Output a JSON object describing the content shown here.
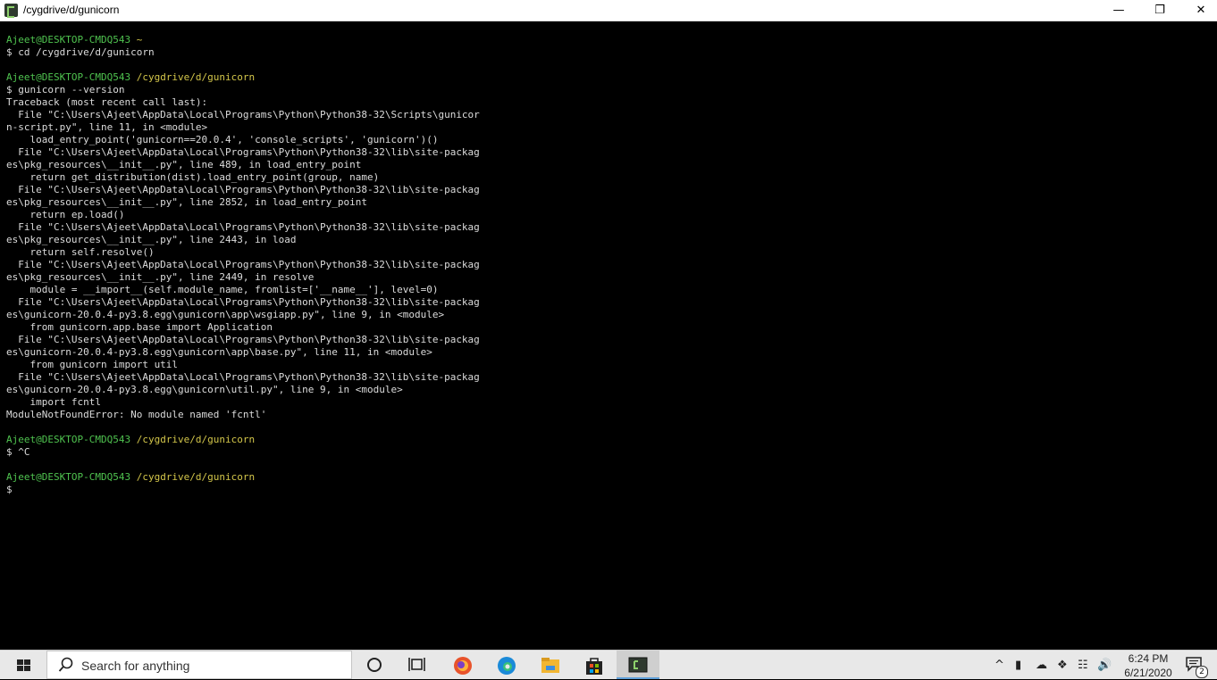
{
  "window": {
    "title": "/cygdrive/d/gunicorn",
    "minimize_glyph": "—",
    "maximize_glyph": "❐",
    "close_glyph": "✕"
  },
  "terminal": {
    "lines": [
      {
        "segments": [
          {
            "text": "Ajeet@DESKTOP-CMDQ543",
            "color": "green"
          },
          {
            "text": " ~",
            "color": "yellow"
          }
        ]
      },
      {
        "segments": [
          {
            "text": "$ cd /cygdrive/d/gunicorn",
            "color": "white"
          }
        ]
      },
      {
        "segments": [
          {
            "text": "",
            "color": "white"
          }
        ]
      },
      {
        "segments": [
          {
            "text": "Ajeet@DESKTOP-CMDQ543",
            "color": "green"
          },
          {
            "text": " /cygdrive/d/gunicorn",
            "color": "yellow"
          }
        ]
      },
      {
        "segments": [
          {
            "text": "$ gunicorn --version",
            "color": "white"
          }
        ]
      },
      {
        "segments": [
          {
            "text": "Traceback (most recent call last):",
            "color": "white"
          }
        ]
      },
      {
        "segments": [
          {
            "text": "  File \"C:\\Users\\Ajeet\\AppData\\Local\\Programs\\Python\\Python38-32\\Scripts\\gunicor",
            "color": "white"
          }
        ]
      },
      {
        "segments": [
          {
            "text": "n-script.py\", line 11, in <module>",
            "color": "white"
          }
        ]
      },
      {
        "segments": [
          {
            "text": "    load_entry_point('gunicorn==20.0.4', 'console_scripts', 'gunicorn')()",
            "color": "white"
          }
        ]
      },
      {
        "segments": [
          {
            "text": "  File \"C:\\Users\\Ajeet\\AppData\\Local\\Programs\\Python\\Python38-32\\lib\\site-packag",
            "color": "white"
          }
        ]
      },
      {
        "segments": [
          {
            "text": "es\\pkg_resources\\__init__.py\", line 489, in load_entry_point",
            "color": "white"
          }
        ]
      },
      {
        "segments": [
          {
            "text": "    return get_distribution(dist).load_entry_point(group, name)",
            "color": "white"
          }
        ]
      },
      {
        "segments": [
          {
            "text": "  File \"C:\\Users\\Ajeet\\AppData\\Local\\Programs\\Python\\Python38-32\\lib\\site-packag",
            "color": "white"
          }
        ]
      },
      {
        "segments": [
          {
            "text": "es\\pkg_resources\\__init__.py\", line 2852, in load_entry_point",
            "color": "white"
          }
        ]
      },
      {
        "segments": [
          {
            "text": "    return ep.load()",
            "color": "white"
          }
        ]
      },
      {
        "segments": [
          {
            "text": "  File \"C:\\Users\\Ajeet\\AppData\\Local\\Programs\\Python\\Python38-32\\lib\\site-packag",
            "color": "white"
          }
        ]
      },
      {
        "segments": [
          {
            "text": "es\\pkg_resources\\__init__.py\", line 2443, in load",
            "color": "white"
          }
        ]
      },
      {
        "segments": [
          {
            "text": "    return self.resolve()",
            "color": "white"
          }
        ]
      },
      {
        "segments": [
          {
            "text": "  File \"C:\\Users\\Ajeet\\AppData\\Local\\Programs\\Python\\Python38-32\\lib\\site-packag",
            "color": "white"
          }
        ]
      },
      {
        "segments": [
          {
            "text": "es\\pkg_resources\\__init__.py\", line 2449, in resolve",
            "color": "white"
          }
        ]
      },
      {
        "segments": [
          {
            "text": "    module = __import__(self.module_name, fromlist=['__name__'], level=0)",
            "color": "white"
          }
        ]
      },
      {
        "segments": [
          {
            "text": "  File \"C:\\Users\\Ajeet\\AppData\\Local\\Programs\\Python\\Python38-32\\lib\\site-packag",
            "color": "white"
          }
        ]
      },
      {
        "segments": [
          {
            "text": "es\\gunicorn-20.0.4-py3.8.egg\\gunicorn\\app\\wsgiapp.py\", line 9, in <module>",
            "color": "white"
          }
        ]
      },
      {
        "segments": [
          {
            "text": "    from gunicorn.app.base import Application",
            "color": "white"
          }
        ]
      },
      {
        "segments": [
          {
            "text": "  File \"C:\\Users\\Ajeet\\AppData\\Local\\Programs\\Python\\Python38-32\\lib\\site-packag",
            "color": "white"
          }
        ]
      },
      {
        "segments": [
          {
            "text": "es\\gunicorn-20.0.4-py3.8.egg\\gunicorn\\app\\base.py\", line 11, in <module>",
            "color": "white"
          }
        ]
      },
      {
        "segments": [
          {
            "text": "    from gunicorn import util",
            "color": "white"
          }
        ]
      },
      {
        "segments": [
          {
            "text": "  File \"C:\\Users\\Ajeet\\AppData\\Local\\Programs\\Python\\Python38-32\\lib\\site-packag",
            "color": "white"
          }
        ]
      },
      {
        "segments": [
          {
            "text": "es\\gunicorn-20.0.4-py3.8.egg\\gunicorn\\util.py\", line 9, in <module>",
            "color": "white"
          }
        ]
      },
      {
        "segments": [
          {
            "text": "    import fcntl",
            "color": "white"
          }
        ]
      },
      {
        "segments": [
          {
            "text": "ModuleNotFoundError: No module named 'fcntl'",
            "color": "white"
          }
        ]
      },
      {
        "segments": [
          {
            "text": "",
            "color": "white"
          }
        ]
      },
      {
        "segments": [
          {
            "text": "Ajeet@DESKTOP-CMDQ543",
            "color": "green"
          },
          {
            "text": " /cygdrive/d/gunicorn",
            "color": "yellow"
          }
        ]
      },
      {
        "segments": [
          {
            "text": "$ ^C",
            "color": "white"
          }
        ]
      },
      {
        "segments": [
          {
            "text": "",
            "color": "white"
          }
        ]
      },
      {
        "segments": [
          {
            "text": "Ajeet@DESKTOP-CMDQ543",
            "color": "green"
          },
          {
            "text": " /cygdrive/d/gunicorn",
            "color": "yellow"
          }
        ]
      },
      {
        "segments": [
          {
            "text": "$",
            "color": "white"
          }
        ]
      }
    ]
  },
  "taskbar": {
    "search_placeholder": "Search for anything",
    "apps": [
      {
        "name": "cortana-icon"
      },
      {
        "name": "task-view-icon"
      },
      {
        "name": "firefox-icon"
      },
      {
        "name": "edge-icon"
      },
      {
        "name": "file-explorer-icon"
      },
      {
        "name": "store-icon"
      },
      {
        "name": "terminal-icon"
      }
    ],
    "time": "6:24 PM",
    "date": "6/21/2020",
    "notification_count": "2"
  },
  "colors": {
    "prompt_user": "#4fc34f",
    "prompt_path": "#d3c64a",
    "text": "#dcdcdc",
    "background": "#000000"
  }
}
